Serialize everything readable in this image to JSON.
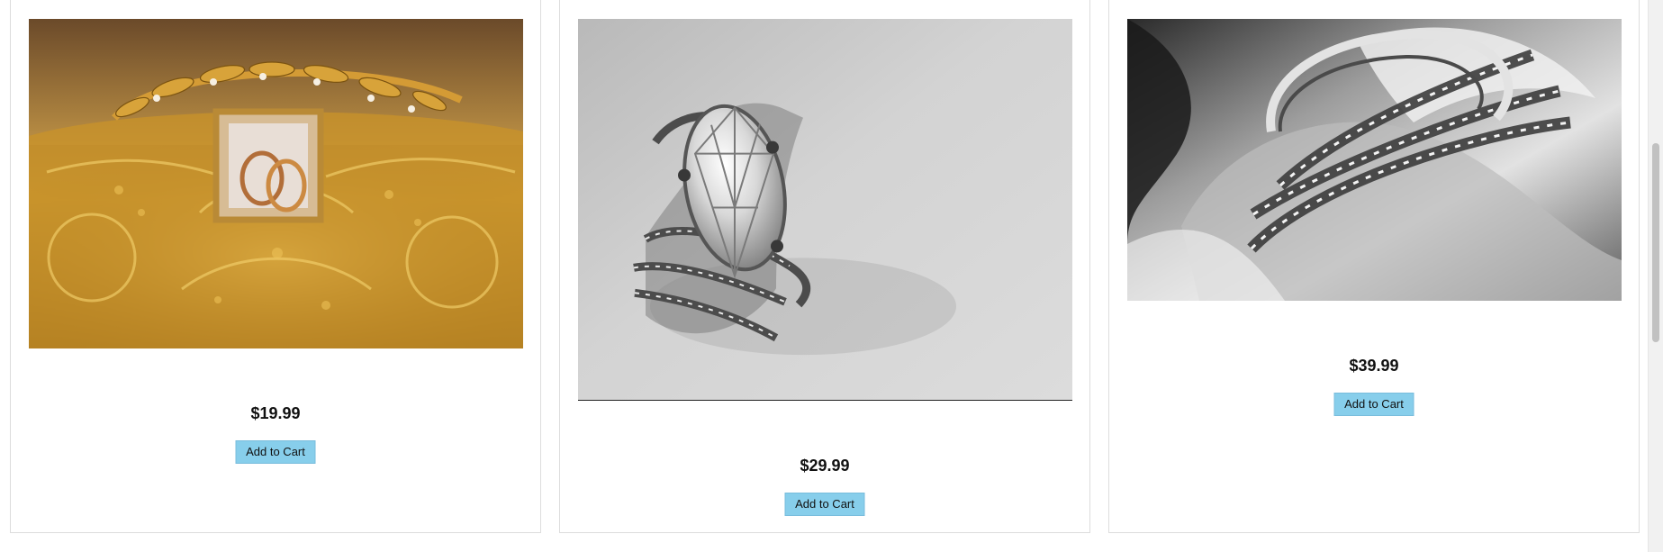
{
  "products": [
    {
      "price": "$19.99",
      "add_to_cart_label": "Add to Cart",
      "image_icon": "golden-rings-box-image"
    },
    {
      "price": "$29.99",
      "add_to_cart_label": "Add to Cart",
      "image_icon": "diamond-ring-image"
    },
    {
      "price": "$39.99",
      "add_to_cart_label": "Add to Cart",
      "image_icon": "silver-bands-rose-image"
    }
  ],
  "colors": {
    "button_bg": "#87ceeb",
    "card_border": "#dddddd",
    "page_bg": "#ffffff"
  }
}
